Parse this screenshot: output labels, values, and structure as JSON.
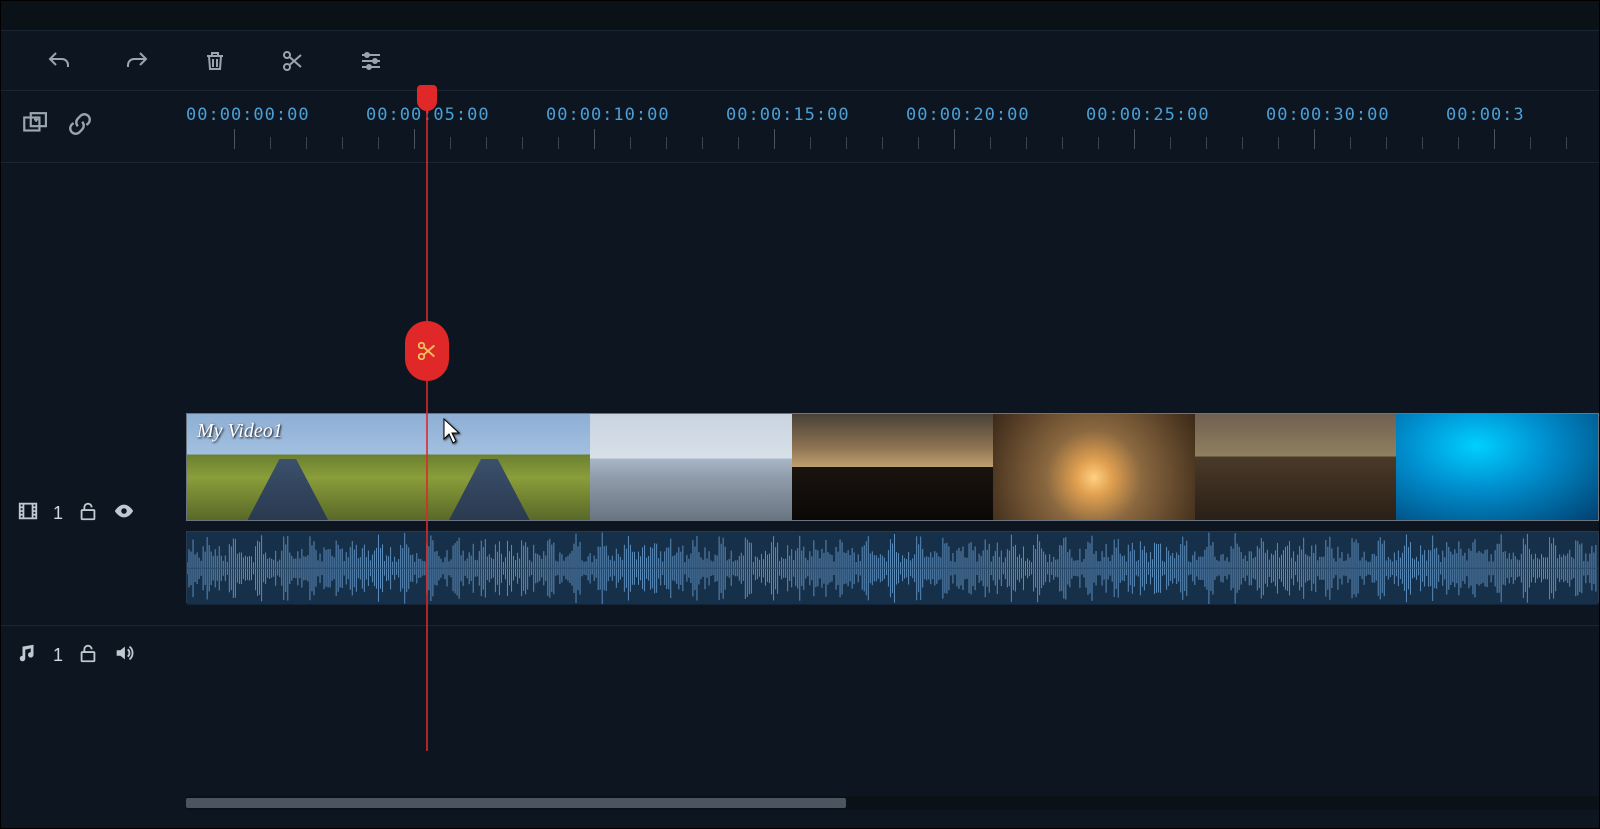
{
  "toolbar": {
    "undo": "undo",
    "redo": "redo",
    "delete": "delete",
    "split": "split",
    "settings": "settings"
  },
  "ruler": {
    "add_marker": "add-marker",
    "link": "link",
    "ticks": [
      "00:00:00:00",
      "00:00:05:00",
      "00:00:10:00",
      "00:00:15:00",
      "00:00:20:00",
      "00:00:25:00",
      "00:00:30:00",
      "00:00:3"
    ]
  },
  "playhead_label": "",
  "video_track": {
    "index": "1",
    "clip_title": "My Video1"
  },
  "music_track": {
    "index": "1"
  }
}
